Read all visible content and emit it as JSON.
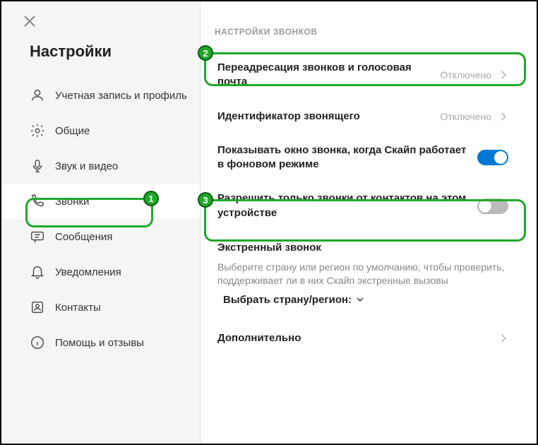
{
  "sidebar": {
    "title": "Настройки",
    "items": [
      {
        "label": "Учетная запись и профиль"
      },
      {
        "label": "Общие"
      },
      {
        "label": "Звук и видео"
      },
      {
        "label": "Звонки"
      },
      {
        "label": "Сообщения"
      },
      {
        "label": "Уведомления"
      },
      {
        "label": "Контакты"
      },
      {
        "label": "Помощь и отзывы"
      }
    ]
  },
  "main": {
    "section_header": "НАСТРОЙКИ ЗВОНКОВ",
    "rows": {
      "forwarding": {
        "label": "Переадресация звонков и голосовая почта",
        "status": "Отключено"
      },
      "caller_id": {
        "label": "Идентификатор звонящего",
        "status": "Отключено"
      },
      "show_window": {
        "label": "Показывать окно звонка, когда Скайп работает в фоновом режиме"
      },
      "contacts_only": {
        "label": "Разрешить только звонки от контактов на этом устройстве"
      },
      "emergency": {
        "title": "Экстренный звонок",
        "desc": "Выберите страну или регион по умолчанию, чтобы проверить, поддерживает ли в них Скайп экстренные вызовы",
        "select_label": "Выбрать страну/регион:"
      },
      "advanced": {
        "label": "Дополнительно"
      }
    }
  },
  "badges": {
    "b1": "1",
    "b2": "2",
    "b3": "3"
  }
}
